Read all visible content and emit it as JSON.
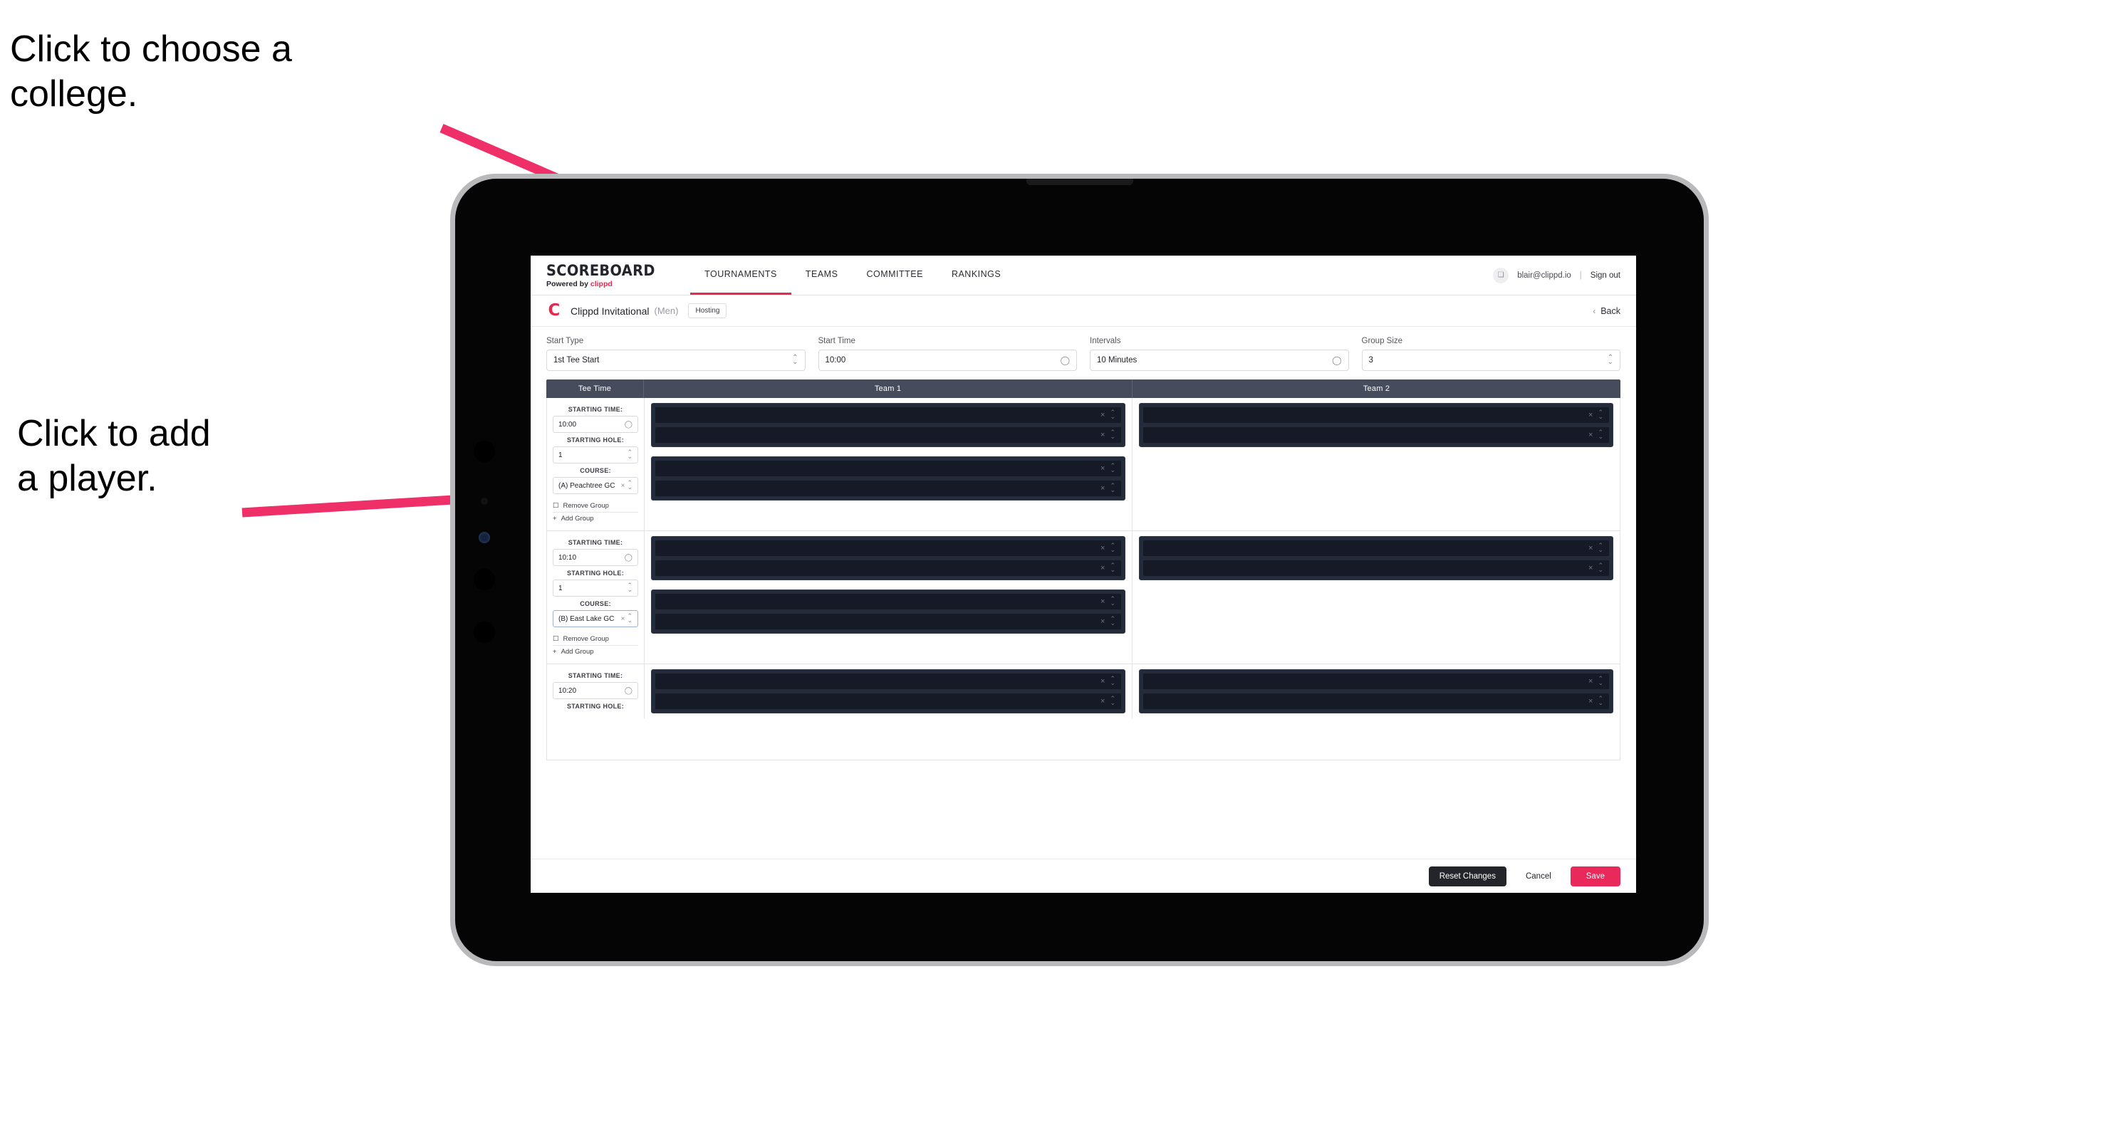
{
  "annotations": [
    {
      "name": "choose-college",
      "text": "Click to choose a\ncollege."
    },
    {
      "name": "add-player",
      "text": "Click to add\na player."
    }
  ],
  "nav": {
    "brand_title": "SCOREBOARD",
    "brand_powered": "Powered by ",
    "brand_name": "clippd",
    "tabs": [
      {
        "label": "TOURNAMENTS",
        "active": true
      },
      {
        "label": "TEAMS",
        "active": false
      },
      {
        "label": "COMMITTEE",
        "active": false
      },
      {
        "label": "RANKINGS",
        "active": false
      }
    ],
    "avatar_glyph": "❑",
    "user_email": "blair@clippd.io",
    "separator": "|",
    "sign_out": "Sign out"
  },
  "subheader": {
    "logo_letter": "C",
    "tournament_name": "Clippd Invitational",
    "gender": "(Men)",
    "badge": "Hosting",
    "back_chevron": "‹",
    "back_label": "Back"
  },
  "controls": [
    {
      "label": "Start Type",
      "value": "1st Tee Start",
      "icon": "stepper"
    },
    {
      "label": "Start Time",
      "value": "10:00",
      "icon": "clock"
    },
    {
      "label": "Intervals",
      "value": "10 Minutes",
      "icon": "clock"
    },
    {
      "label": "Group Size",
      "value": "3",
      "icon": "stepper"
    }
  ],
  "table": {
    "headers": [
      "Tee Time",
      "Team 1",
      "Team 2"
    ],
    "field_labels": {
      "starting_time": "STARTING TIME:",
      "starting_hole": "STARTING HOLE:",
      "course": "COURSE:"
    },
    "group_actions": {
      "remove": "Remove Group",
      "remove_icon": "☐",
      "add": "Add Group",
      "add_icon": "+"
    },
    "slot_icons": {
      "clear": "×",
      "stepper_up": "⌃",
      "stepper_down": "⌄"
    },
    "groups": [
      {
        "starting_time": "10:00",
        "starting_hole": "1",
        "course": "(A) Peachtree GC",
        "course_clearable": true,
        "course_focused": false,
        "team1_blocks": [
          2,
          2
        ],
        "team2_blocks": [
          2
        ]
      },
      {
        "starting_time": "10:10",
        "starting_hole": "1",
        "course": "(B) East Lake GC",
        "course_clearable": true,
        "course_focused": true,
        "team1_blocks": [
          2,
          2
        ],
        "team2_blocks": [
          2
        ]
      },
      {
        "starting_time": "10:20",
        "starting_hole": "",
        "course": "",
        "course_clearable": false,
        "course_focused": false,
        "team1_blocks": [
          2
        ],
        "team2_blocks": [
          2
        ]
      }
    ]
  },
  "footer": {
    "reset_label": "Reset Changes",
    "cancel_label": "Cancel",
    "save_label": "Save"
  },
  "colors": {
    "accent_pink": "#e8295a",
    "brand_red": "#e8294f",
    "table_header": "#464c5c",
    "slot_dark": "#151a26",
    "annotation_arrow": "#ef2f68"
  }
}
